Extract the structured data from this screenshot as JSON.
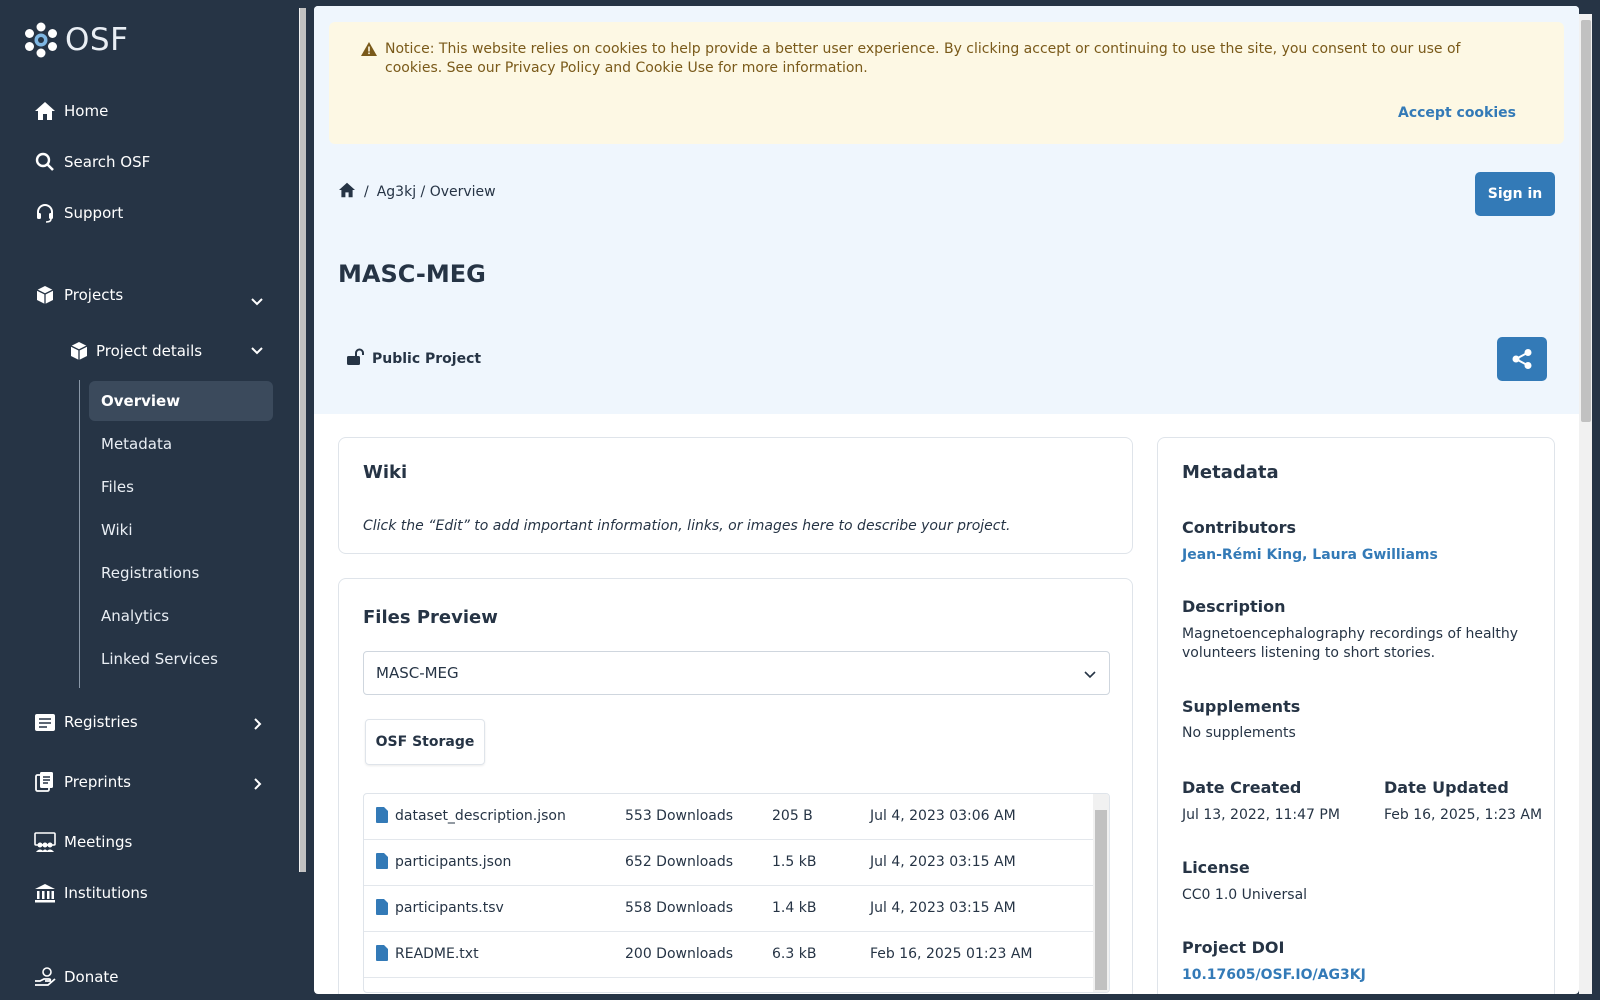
{
  "sidebar": {
    "logo_text": "OSF",
    "nav": {
      "home": "Home",
      "search": "Search OSF",
      "support": "Support",
      "projects": "Projects",
      "project_details": "Project details",
      "registries": "Registries",
      "preprints": "Preprints",
      "meetings": "Meetings",
      "institutions": "Institutions",
      "donate": "Donate"
    },
    "project_items": [
      "Overview",
      "Metadata",
      "Files",
      "Wiki",
      "Registrations",
      "Analytics",
      "Linked Services"
    ],
    "active_item": "Overview"
  },
  "notice": {
    "text": "Notice: This website relies on cookies to help provide a better user experience. By clicking accept or continuing to use the site, you consent to our use of cookies. See our Privacy Policy and Cookie Use for more information.",
    "accept_label": "Accept cookies"
  },
  "breadcrumb": {
    "separator": "/",
    "path": "Ag3kj / Overview"
  },
  "header": {
    "signin_label": "Sign in",
    "title": "MASC-MEG",
    "visibility": "Public Project"
  },
  "wiki": {
    "title": "Wiki",
    "placeholder": "Click the “Edit” to add important information, links, or images here to describe your project."
  },
  "files_preview": {
    "title": "Files Preview",
    "selected_project": "MASC-MEG",
    "storage_label": "OSF Storage",
    "files": [
      {
        "name": "dataset_description.json",
        "downloads": "553 Downloads",
        "size": "205 B",
        "date": "Jul 4, 2023 03:06 AM"
      },
      {
        "name": "participants.json",
        "downloads": "652 Downloads",
        "size": "1.5 kB",
        "date": "Jul 4, 2023 03:15 AM"
      },
      {
        "name": "participants.tsv",
        "downloads": "558 Downloads",
        "size": "1.4 kB",
        "date": "Jul 4, 2023 03:15 AM"
      },
      {
        "name": "README.txt",
        "downloads": "200 Downloads",
        "size": "6.3 kB",
        "date": "Feb 16, 2025 01:23 AM"
      }
    ]
  },
  "metadata": {
    "title": "Metadata",
    "contributors_label": "Contributors",
    "contributors": "Jean-Rémi King, Laura Gwilliams",
    "description_label": "Description",
    "description": "Magnetoencephalography recordings of healthy volunteers listening to short stories.",
    "supplements_label": "Supplements",
    "supplements": "No supplements",
    "date_created_label": "Date Created",
    "date_created": "Jul 13, 2022, 11:47 PM",
    "date_updated_label": "Date Updated",
    "date_updated": "Feb 16, 2025, 1:23 AM",
    "license_label": "License",
    "license": "CC0 1.0 Universal",
    "doi_label": "Project DOI",
    "doi": "10.17605/OSF.IO/AG3KJ"
  },
  "colors": {
    "sidebar_bg": "#263445",
    "accent": "#337ab7",
    "hero_bg": "#eff6fd",
    "notice_bg": "#fdf8e4"
  }
}
